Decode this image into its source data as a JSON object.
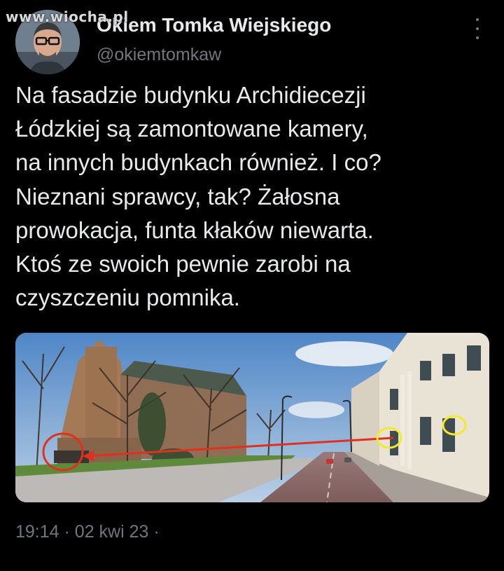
{
  "watermark": "www.wiocha.pl",
  "author": {
    "name": "Okiem Tomka Wiejskiego",
    "handle": "@okiemtomkaw"
  },
  "menu_icon": "more-vertical-icon",
  "tweet": {
    "lines": [
      "Na fasadzie budynku Archidiecezji",
      "Łódzkiej są zamontowane kamery,",
      "na innych budynkach również. I co?",
      "Nieznani sprawcy, tak? Żałosna",
      "prowokacja, funta kłaków niewarta.",
      "Ktoś ze swoich pewnie zarobi na",
      "czyszczeniu pomnika."
    ]
  },
  "media": {
    "annotation_colors": {
      "circle": "#e0301e",
      "arrow": "#e0301e",
      "camera_markers": "#f2ea2a"
    }
  },
  "meta": {
    "time": "19:14",
    "separator": "·",
    "date": "02 kwi 23",
    "trailing": "·"
  },
  "colors": {
    "background": "#000000",
    "primary_text": "#e7e9ea",
    "secondary_text": "#71767b"
  }
}
